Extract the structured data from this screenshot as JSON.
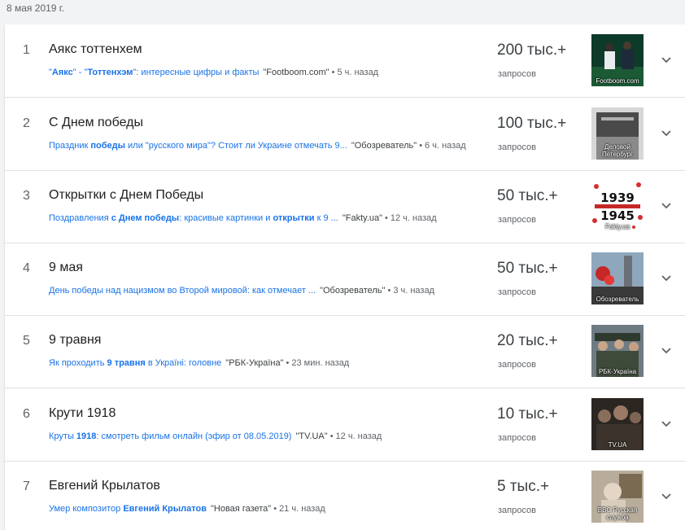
{
  "date_header": "8 мая 2019 г.",
  "count_label": "запросов",
  "trends": [
    {
      "rank": "1",
      "title": "Аякс тоттенхем",
      "article": [
        {
          "t": "\"",
          "b": false
        },
        {
          "t": "Аякс",
          "b": true
        },
        {
          "t": "\" - \"",
          "b": false
        },
        {
          "t": "Тоттенхэм",
          "b": true
        },
        {
          "t": "\": интересные цифры и факты",
          "b": false
        }
      ],
      "source": "\"Footboom.com\"",
      "age": "5 ч. назад",
      "count": "200 тыс.+",
      "thumb_caption": "Footboom.com"
    },
    {
      "rank": "2",
      "title": "С Днем победы",
      "article": [
        {
          "t": "Праздник ",
          "b": false
        },
        {
          "t": "победы",
          "b": true
        },
        {
          "t": " или \"русского мира\"? Стоит ли Украине отмечать 9...",
          "b": false
        }
      ],
      "source": "\"Обозреватель\"",
      "age": "6 ч. назад",
      "count": "100 тыс.+",
      "thumb_caption": "Деловой Петербург"
    },
    {
      "rank": "3",
      "title": "Открытки с Днем Победы",
      "article": [
        {
          "t": "Поздравления ",
          "b": false
        },
        {
          "t": "с Днем победы",
          "b": true
        },
        {
          "t": ": красивые картинки и ",
          "b": false
        },
        {
          "t": "открытки",
          "b": true
        },
        {
          "t": " к 9 ...",
          "b": false
        }
      ],
      "source": "\"Fakty.ua\"",
      "age": "12 ч. назад",
      "count": "50 тыс.+",
      "thumb_caption": "Fakty.ua",
      "thumb_text_top": "1939",
      "thumb_text_bottom": "1945"
    },
    {
      "rank": "4",
      "title": "9 мая",
      "article": [
        {
          "t": "День победы над нацизмом во Второй мировой: как отмечает ...",
          "b": false
        }
      ],
      "source": "\"Обозреватель\"",
      "age": "3 ч. назад",
      "count": "50 тыс.+",
      "thumb_caption": "Обозреватель"
    },
    {
      "rank": "5",
      "title": "9 травня",
      "article": [
        {
          "t": "Як проходить ",
          "b": false
        },
        {
          "t": "9 травня",
          "b": true
        },
        {
          "t": " в Україні: головне",
          "b": false
        }
      ],
      "source": "\"РБК-Україна\"",
      "age": "23 мин. назад",
      "count": "20 тыс.+",
      "thumb_caption": "РБК-Україна"
    },
    {
      "rank": "6",
      "title": "Крути 1918",
      "article": [
        {
          "t": "Круты ",
          "b": false
        },
        {
          "t": "1918",
          "b": true
        },
        {
          "t": ": смотреть фильм онлайн (эфир от 08.05.2019)",
          "b": false
        }
      ],
      "source": "\"TV.UA\"",
      "age": "12 ч. назад",
      "count": "10 тыс.+",
      "thumb_caption": "TV.UA"
    },
    {
      "rank": "7",
      "title": "Евгений Крылатов",
      "article": [
        {
          "t": "Умер композитор ",
          "b": false
        },
        {
          "t": "Евгений Крылатов",
          "b": true
        }
      ],
      "source": "\"Новая газета\"",
      "age": "21 ч. назад",
      "count": "5 тыс.+",
      "thumb_caption": "BBC Русская служба"
    }
  ],
  "colors": {
    "link": "#1a73e8",
    "divider": "#e0e0e0",
    "background": "#f1f3f4"
  },
  "icons": {
    "expand": "chevron-down-icon"
  }
}
